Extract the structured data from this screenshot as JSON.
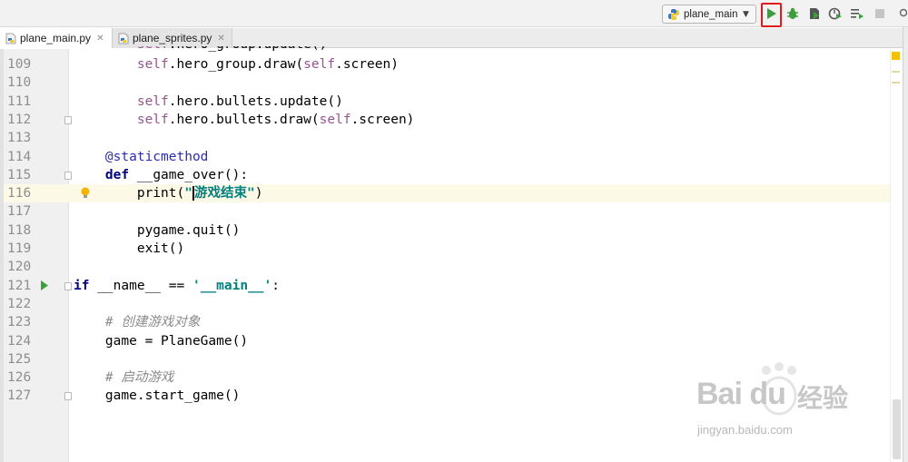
{
  "toolbar": {
    "run_config_label": "plane_main",
    "run_config_icon": "python-file-icon",
    "buttons": [
      "run-icon",
      "debug-icon",
      "coverage-icon",
      "profile-icon",
      "concurrency-icon",
      "stop-icon"
    ]
  },
  "tabs": [
    {
      "label": "plane_main.py",
      "active": true
    },
    {
      "label": "plane_sprites.py",
      "active": false
    }
  ],
  "editor": {
    "lines": [
      {
        "num": "109",
        "html": "        <span class=\"self\">self</span>.hero_group.draw(<span class=\"self\">self</span>.screen)"
      },
      {
        "num": "110",
        "html": ""
      },
      {
        "num": "111",
        "html": "        <span class=\"self\">self</span>.hero.bullets.update()"
      },
      {
        "num": "112",
        "html": "        <span class=\"self\">self</span>.hero.bullets.draw(<span class=\"self\">self</span>.screen)"
      },
      {
        "num": "113",
        "html": ""
      },
      {
        "num": "114",
        "html": "    <span class=\"dec\">@staticmethod</span>"
      },
      {
        "num": "115",
        "html": "    <span class=\"kw\">def</span> __game_over():"
      },
      {
        "num": "116",
        "html": "        print(<span class=\"str\">\"<span class=\"caret\"></span>游戏结束\"</span>)"
      },
      {
        "num": "117",
        "html": ""
      },
      {
        "num": "118",
        "html": "        pygame.quit()"
      },
      {
        "num": "119",
        "html": "        exit()"
      },
      {
        "num": "120",
        "html": ""
      },
      {
        "num": "121",
        "html": "<span class=\"kw\">if</span> __name__ == <span class=\"str\">'__main__'</span>:"
      },
      {
        "num": "122",
        "html": ""
      },
      {
        "num": "123",
        "html": "    <span class=\"cm\"># 创建游戏对象</span>"
      },
      {
        "num": "124",
        "html": "    game = PlaneGame()"
      },
      {
        "num": "125",
        "html": ""
      },
      {
        "num": "126",
        "html": "    <span class=\"cm\"># 启动游戏</span>"
      },
      {
        "num": "127",
        "html": "    game.start_game()"
      }
    ],
    "current_line": "116"
  },
  "watermark": {
    "brand": "Bai du",
    "cn": "经验",
    "url": "jingyan.baidu.com"
  }
}
